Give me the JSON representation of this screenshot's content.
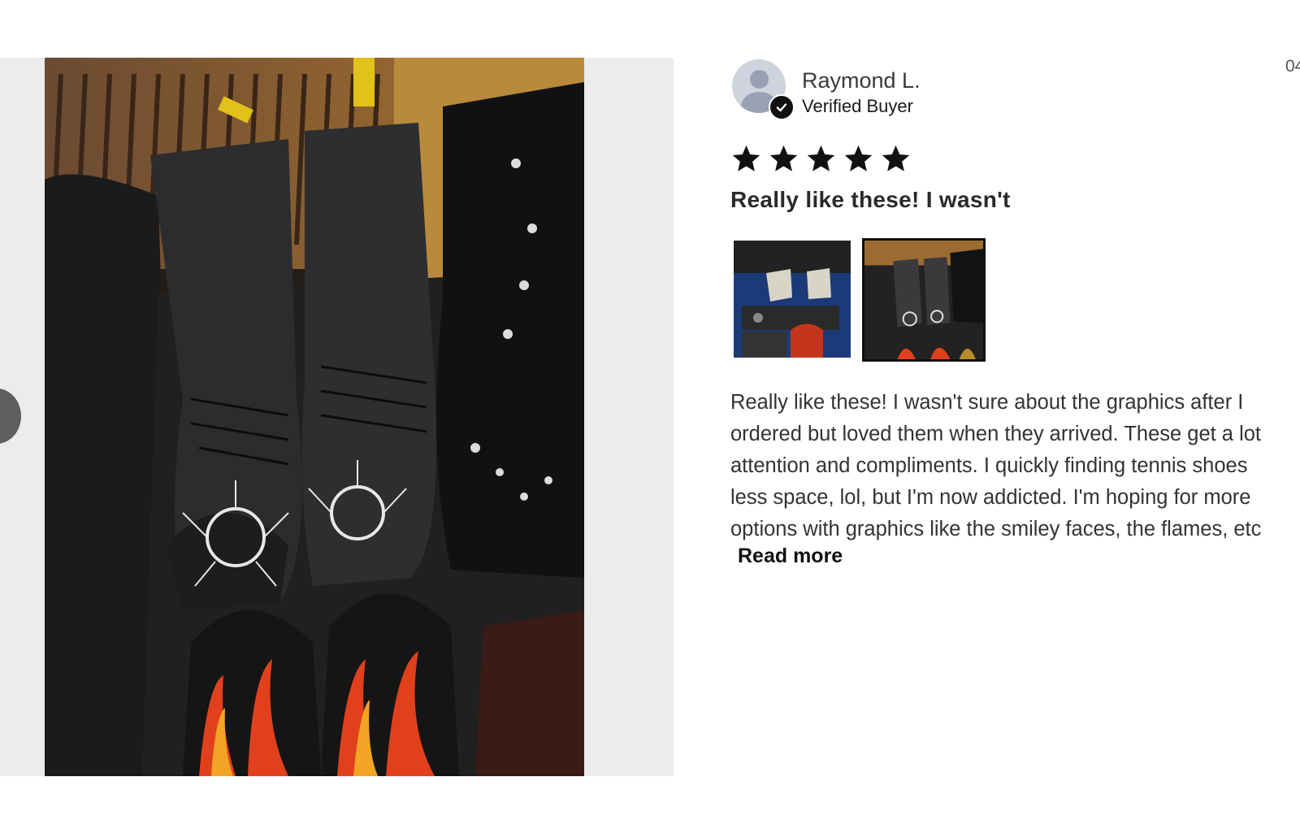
{
  "gallery": {
    "prev_icon": "chevron-left-icon"
  },
  "review": {
    "reviewer_name": "Raymond L.",
    "reviewer_status": "Verified Buyer",
    "date": "04",
    "rating": 5,
    "rating_max": 5,
    "title": "Really like these! I wasn't",
    "body_lines": [
      "Really like these! I wasn't sure about the graphics after I",
      "ordered but loved them when they arrived. These get a lot",
      "attention and compliments. I quickly finding tennis shoes",
      "less space, lol, but I'm now addicted. I'm hoping for more",
      "options with graphics like the smiley faces, the flames, etc"
    ],
    "read_more_label": "Read more",
    "thumbnail_count": 2,
    "active_thumbnail": 2
  },
  "colors": {
    "star": "#111111",
    "gallery_bg": "#ececec",
    "badge": "#111111"
  }
}
